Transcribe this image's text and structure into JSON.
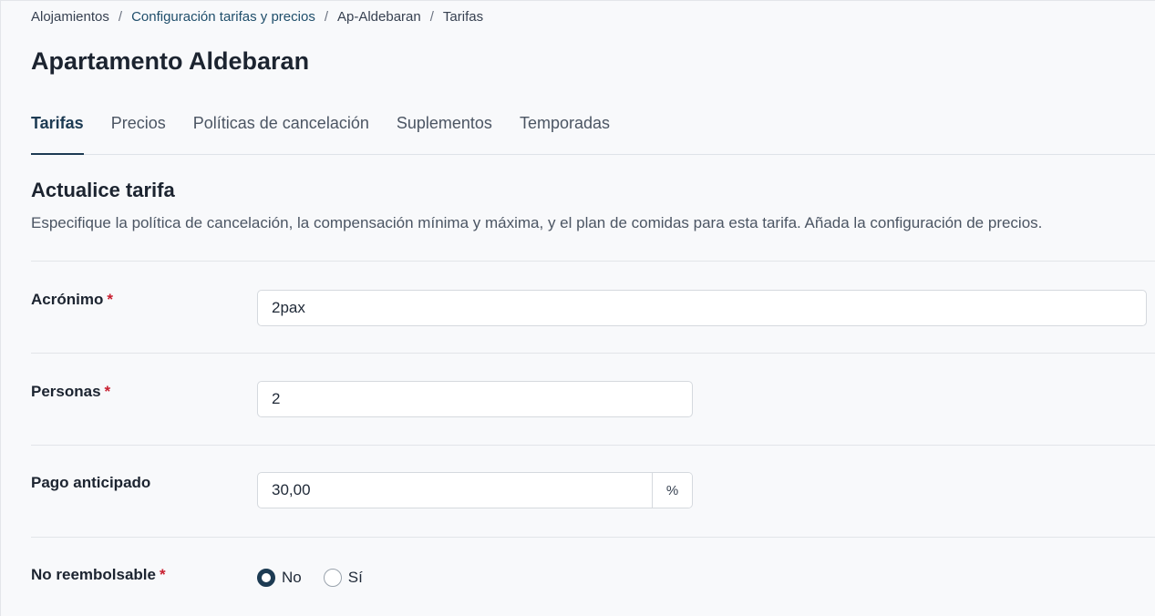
{
  "breadcrumb": {
    "items": [
      {
        "label": "Alojamientos"
      },
      {
        "label": "Configuración tarifas y precios"
      },
      {
        "label": "Ap-Aldebaran"
      },
      {
        "label": "Tarifas"
      }
    ],
    "separator": "/"
  },
  "page": {
    "title": "Apartamento Aldebaran"
  },
  "tabs": [
    {
      "label": "Tarifas",
      "active": true
    },
    {
      "label": "Precios",
      "active": false
    },
    {
      "label": "Políticas de cancelación",
      "active": false
    },
    {
      "label": "Suplementos",
      "active": false
    },
    {
      "label": "Temporadas",
      "active": false
    }
  ],
  "section": {
    "title": "Actualice tarifa",
    "description": "Especifique la política de cancelación, la compensación mínima y máxima, y el plan de comidas para esta tarifa. Añada la configuración de precios."
  },
  "form": {
    "required_marker": "*",
    "acronym": {
      "label": "Acrónimo",
      "value": "2pax",
      "required": true
    },
    "persons": {
      "label": "Personas",
      "value": "2",
      "required": true
    },
    "prepayment": {
      "label": "Pago anticipado",
      "value": "30,00",
      "unit": "%",
      "required": false
    },
    "non_refundable": {
      "label": "No reembolsable",
      "required": true,
      "options": [
        {
          "label": "No",
          "checked": true
        },
        {
          "label": "Sí",
          "checked": false
        }
      ]
    }
  },
  "colors": {
    "accent": "#1d3b53",
    "required": "#c81e2f",
    "background": "#f8f9fb",
    "link": "#1f4e6b"
  }
}
